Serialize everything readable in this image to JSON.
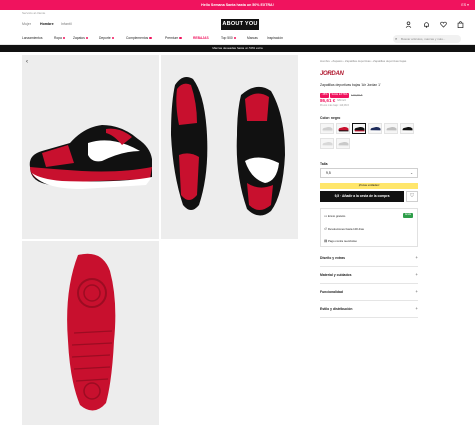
{
  "promo": {
    "text": "Hello Semana Santa hasta un 50% EXTRA!",
    "lang": "ES ▾"
  },
  "topline": {
    "service": "Servicio al cliente"
  },
  "header": {
    "genders": [
      "Mujer",
      "Hombre",
      "Infantil"
    ],
    "logo": "ABOUT YOU",
    "icons": [
      "user-icon",
      "bell-icon",
      "heart-icon",
      "bag-icon"
    ]
  },
  "nav": {
    "items": [
      "Lanzamientos",
      "Ropa",
      "Zapatos",
      "Deporte",
      "Complementos",
      "Premium",
      "REBAJAS",
      "Top 500",
      "Marcas",
      "Inspiración"
    ],
    "search_placeholder": "Buscar artículos, marcas y más..."
  },
  "blackbar": {
    "text": "Marcas deseadas hasta un 50% extra"
  },
  "breadcrumb": "Hombre  ›  Zapatos  ›  Zapatillas deportivas  ›  Zapatillas deportivas bajas",
  "product": {
    "brand": "JORDAN",
    "name": "Zapatillas deportivas bajas 'Air Jordan 1'",
    "tags": [
      "-15%",
      "SALE EXTRA"
    ],
    "old_price": "119,99 €",
    "price": "86,61 €",
    "price_sub": "IVA incl.",
    "price_note": "Precio más bajo: 119,99 €",
    "color_label": "Color: negro",
    "size_label": "Talla",
    "size_value": "9,5",
    "notice": "¡Pocas unidades!",
    "cart_button": "9,5 · Añadir a la cesta de la compra",
    "info_rows": [
      "Envío gratuito",
      "Devoluciones hasta 100 días",
      "Pago contra reembolso"
    ],
    "info_badge": "Gratis",
    "accordions": [
      "Diseño y extras",
      "Material y cuidados",
      "Funcionalidad",
      "Estilo y distribución"
    ]
  },
  "colors": {
    "accent": "#f0135e",
    "black": "#111111",
    "notice": "#ffe66b",
    "green": "#2e9e4a",
    "shoe_red": "#c8102e"
  }
}
